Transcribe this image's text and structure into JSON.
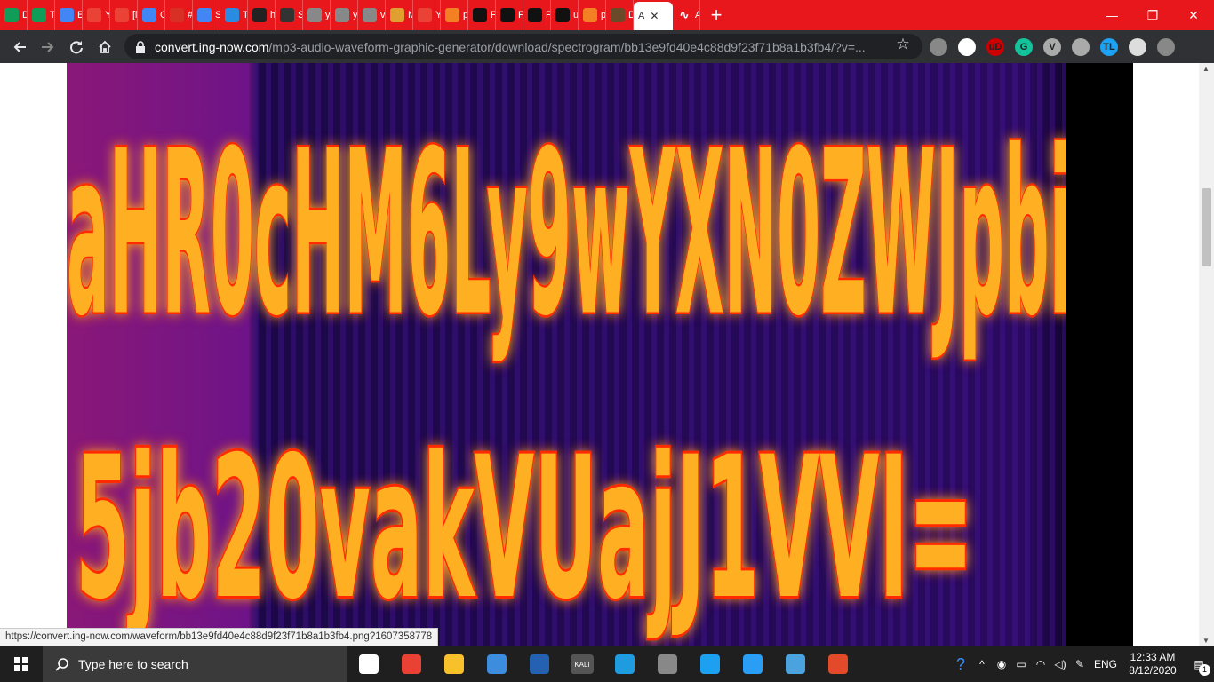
{
  "tabs": [
    {
      "letter": "D",
      "color": "#0f9d58",
      "icon": "sheets-icon"
    },
    {
      "letter": "T",
      "color": "#0f9d58",
      "icon": "sheets-icon"
    },
    {
      "letter": "E",
      "color": "#4285f4",
      "icon": "docs-icon"
    },
    {
      "letter": "Y",
      "color": "#ea4335",
      "icon": "gmail-icon"
    },
    {
      "letter": "[l",
      "color": "#ea4335",
      "icon": "gmail-icon"
    },
    {
      "letter": "G",
      "color": "#4285f4",
      "icon": "docs-icon"
    },
    {
      "letter": "#",
      "color": "#d93025",
      "icon": "keep-icon"
    },
    {
      "letter": "S",
      "color": "#4285f4",
      "icon": "docs-icon"
    },
    {
      "letter": "T",
      "color": "#2b8be0",
      "icon": "telegram-icon"
    },
    {
      "letter": "h",
      "color": "#222",
      "icon": "qr-icon"
    },
    {
      "letter": "S",
      "color": "#333",
      "icon": "cube-icon"
    },
    {
      "letter": "y",
      "color": "#888",
      "icon": "globe-icon"
    },
    {
      "letter": "y",
      "color": "#888",
      "icon": "globe-icon"
    },
    {
      "letter": "v",
      "color": "#888",
      "icon": "globe-icon"
    },
    {
      "letter": "M",
      "color": "#e0a030",
      "icon": "music-icon"
    },
    {
      "letter": "Y",
      "color": "#ea4335",
      "icon": "gmail-icon"
    },
    {
      "letter": "p",
      "color": "#f48024",
      "icon": "stackoverflow-icon"
    },
    {
      "letter": "P",
      "color": "#111",
      "icon": "github-icon"
    },
    {
      "letter": "P",
      "color": "#111",
      "icon": "github-icon"
    },
    {
      "letter": "P",
      "color": "#111",
      "icon": "github-icon"
    },
    {
      "letter": "u",
      "color": "#111",
      "icon": "github-icon"
    },
    {
      "letter": "p",
      "color": "#f48024",
      "icon": "stackoverflow-icon"
    },
    {
      "letter": "D",
      "color": "#6b4a2a",
      "icon": "avatar-icon"
    }
  ],
  "active_tab": {
    "letter": "A",
    "close": "✕"
  },
  "last_tab": {
    "letter": "A",
    "icon": "waveform-icon"
  },
  "new_tab": "+",
  "window_controls": {
    "minimize": "—",
    "maximize": "❐",
    "close": "✕"
  },
  "address": {
    "host": "convert.ing-now.com",
    "path": "/mp3-audio-waveform-graphic-generator/download/spectrogram/bb13e9fd40e4c88d9f23f71b8a1b3fb4/?v=..."
  },
  "extensions": [
    {
      "label": "",
      "icon": "shield-ext-icon",
      "color": "#888"
    },
    {
      "label": "",
      "icon": "incognito-ext-icon",
      "color": "#fff"
    },
    {
      "label": "uD",
      "icon": "ublock-icon",
      "color": "#c00"
    },
    {
      "label": "G",
      "icon": "grammarly-icon",
      "color": "#15c39a"
    },
    {
      "label": "V",
      "icon": "vue-devtools-icon",
      "color": "#aaa"
    },
    {
      "label": "",
      "icon": "drive-icon",
      "color": "#aaa"
    },
    {
      "label": "TL",
      "icon": "translate-icon",
      "color": "#1da1f2"
    },
    {
      "label": "",
      "icon": "puzzle-icon",
      "color": "#ddd"
    },
    {
      "label": "",
      "icon": "profile-avatar-icon",
      "color": "#888"
    }
  ],
  "status_url": "https://convert.ing-now.com/waveform/bb13e9fd40e4c88d9f23f71b8a1b3fb4.png?1607358778",
  "spectrogram": {
    "line1": "aHR0cHM6Ly9wYXN0ZWJpbi",
    "line2": "5jb20vakVUajJ1VVI=",
    "colors": {
      "bg_dark": "#1a0640",
      "bg_mid": "#5a1280",
      "glow": "#ff3a00",
      "core": "#ffd23a"
    }
  },
  "taskbar": {
    "search_placeholder": "Type here to search",
    "apps": [
      {
        "icon": "task-view-icon"
      },
      {
        "icon": "chrome-icon"
      },
      {
        "icon": "file-explorer-icon"
      },
      {
        "icon": "control-panel-icon"
      },
      {
        "icon": "powershell-icon"
      },
      {
        "icon": "kali-icon",
        "label": "KALI"
      },
      {
        "icon": "edge-icon"
      },
      {
        "icon": "snipping-icon"
      },
      {
        "icon": "ie-icon"
      },
      {
        "icon": "phone-icon"
      },
      {
        "icon": "photos-icon"
      },
      {
        "icon": "rocket-icon"
      }
    ],
    "lang": "ENG",
    "time": "12:33 AM",
    "date": "8/12/2020",
    "notifications": "1"
  }
}
